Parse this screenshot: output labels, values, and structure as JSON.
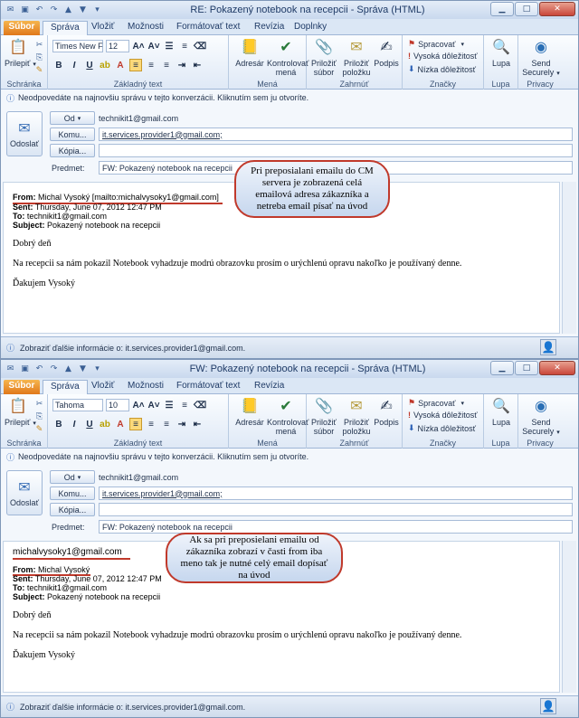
{
  "ribbon": {
    "tabs": [
      "Súbor",
      "Správa",
      "Vložiť",
      "Možnosti",
      "Formátovať text",
      "Revízia",
      "Doplnky"
    ],
    "paste_label": "Prilepiť",
    "clipboard_group": "Schránka",
    "basic_text_group": "Základný text",
    "names_group": "Mená",
    "include_group": "Zahrnúť",
    "tags_group": "Značky",
    "zoom_group": "Lupa",
    "privacy_group": "Privacy",
    "address_book": "Adresár",
    "check_names": "Kontrolovať mená",
    "attach_file": "Priložiť súbor",
    "attach_item": "Priložiť položku",
    "signature": "Podpis",
    "follow_up": "Spracovať",
    "high_importance": "Vysoká dôležitosť",
    "low_importance": "Nízka dôležitosť",
    "zoom": "Lupa",
    "send_securely": "Send Securely",
    "font_size": "12"
  },
  "compose": {
    "info_bar": "Neodpovedáte na najnovšiu správu v tejto konverzácii. Kliknutím sem ju otvoríte.",
    "send_label": "Odoslať",
    "from_button": "Od",
    "from_value": "technikit1@gmail.com",
    "to_button": "Komu...",
    "to_value": "it.services.provider1@gmail.com;",
    "cc_button": "Kópia...",
    "subject_label": "Predmet:",
    "status_text": "Zobraziť ďalšie informácie o: it.services.provider1@gmail.com."
  },
  "window1": {
    "title": "RE: Pokazený notebook na recepcii - Správa (HTML)",
    "font_name": "Times New F",
    "subject_value": "FW: Pokazený notebook na recepcii",
    "from_line_label": "From:",
    "from_line_value": "Michal Vysoký [mailto:michalvysoky1@gmail.com]",
    "sent_label": "Sent:",
    "sent_value": "Thursday, June 07, 2012 12:47 PM",
    "to_label": "To:",
    "to_value": "technikit1@gmail.com",
    "subject_line_label": "Subject:",
    "subject_line_value": "Pokazený notebook na recepcii",
    "greeting": "Dobrý deň",
    "message": "Na recepcii sa nám pokazil Notebook vyhadzuje modrú obrazovku prosím o urýchlenú opravu nakoľko je používaný denne.",
    "thanks": "Ďakujem  Vysoký",
    "callout": "Pri preposialani emailu do CM servera je zobrazená celá emailová adresa zákazníka a netreba email písať na úvod"
  },
  "window2": {
    "title": "FW: Pokazený notebook na recepcii - Správa (HTML)",
    "font_name": "Tahoma",
    "font_size": "10",
    "subject_value": "FW: Pokazený notebook na recepcii",
    "typed_email": "michalvysoky1@gmail.com",
    "from_line_label": "From:",
    "from_line_value": "Michal Vysoký",
    "sent_label": "Sent:",
    "sent_value": "Thursday, June 07, 2012 12:47 PM",
    "to_label": "To:",
    "to_value": "technikit1@gmail.com",
    "subject_line_label": "Subject:",
    "subject_line_value": "Pokazený notebook na recepcii",
    "greeting": "Dobrý deň",
    "message": "Na recepcii sa nám pokazil Notebook vyhadzuje modrú obrazovku prosím o urýchlenú opravu nakoľko je používaný denne.",
    "thanks": "Ďakujem  Vysoký",
    "callout": "Ak sa pri preposielani emailu od zákazníka zobrazí v časti from iba meno tak je nutné celý email  dopísať na úvod"
  }
}
